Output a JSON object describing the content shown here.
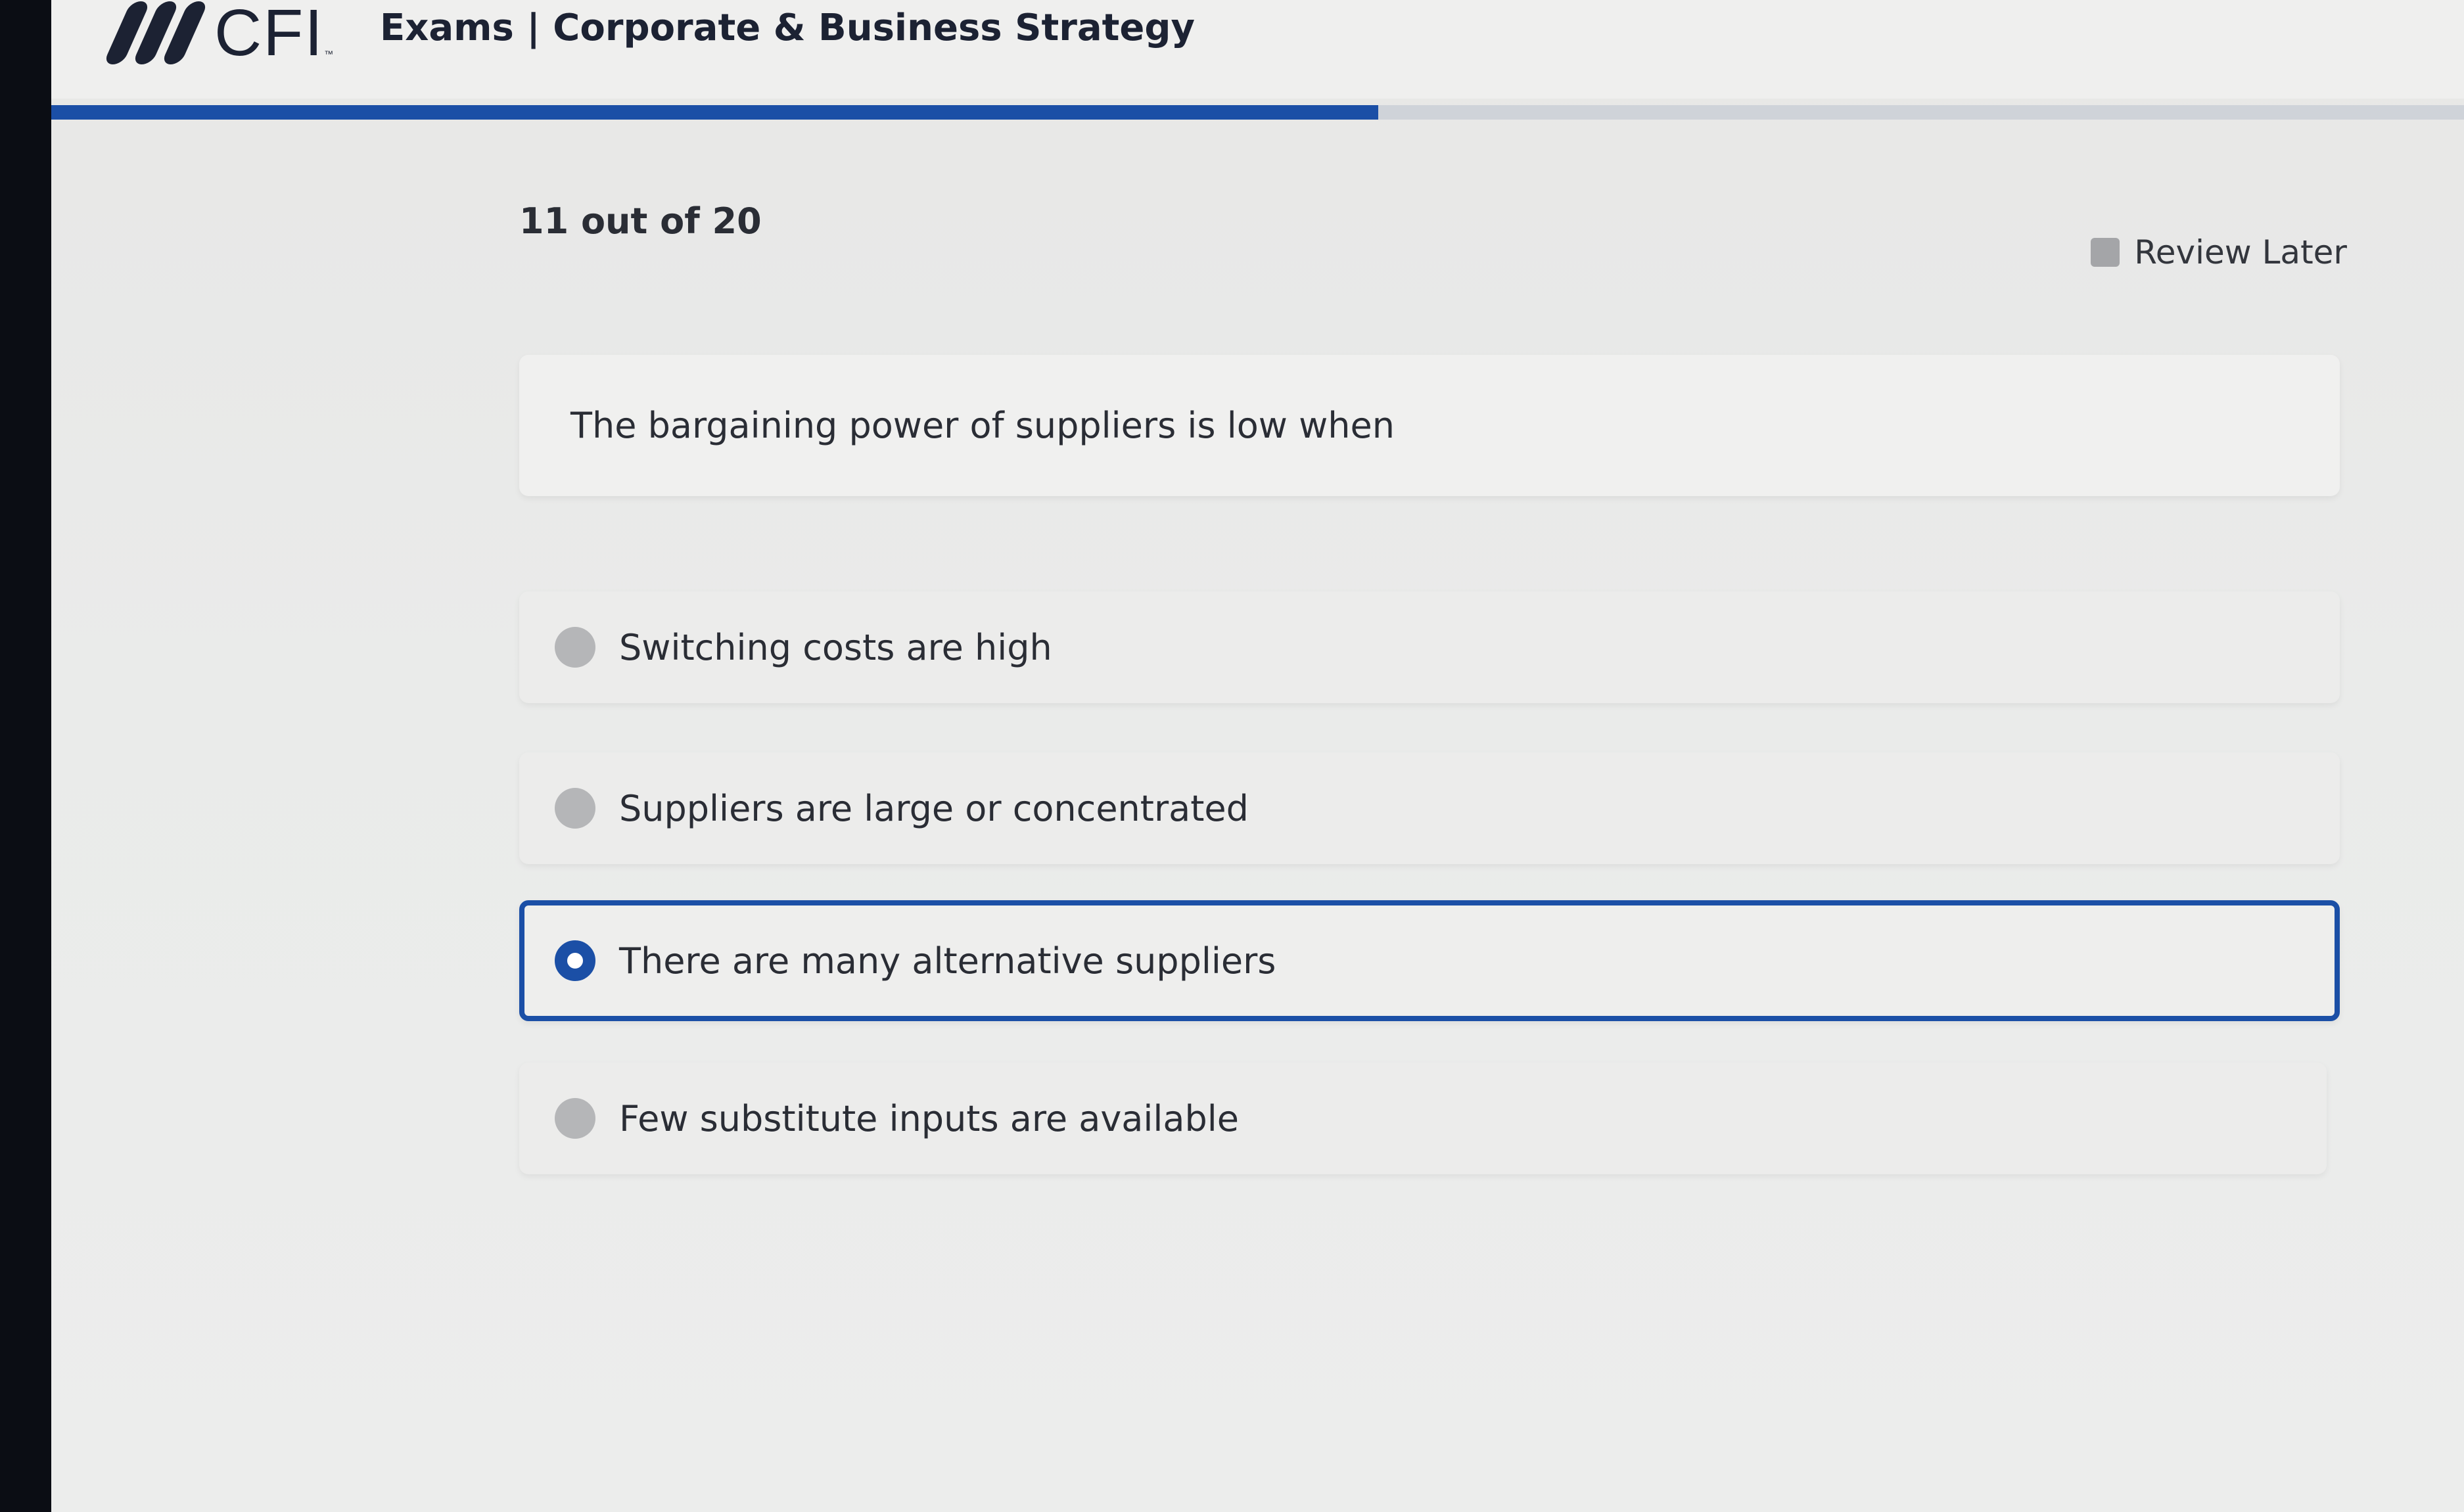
{
  "header": {
    "logo_text": "CFI",
    "logo_tm": "™",
    "title": "Exams | Corporate & Business Strategy"
  },
  "progress": {
    "current": 11,
    "total": 20,
    "fraction": 0.55,
    "counter_text": "11 out of 20",
    "color": "#1b4fa6"
  },
  "review": {
    "label": "Review Later",
    "checked": false
  },
  "question": {
    "text": "The bargaining power of suppliers is low when"
  },
  "options": [
    {
      "label": "Switching costs are high",
      "selected": false
    },
    {
      "label": "Suppliers are large or concentrated",
      "selected": false
    },
    {
      "label": "There are many alternative suppliers",
      "selected": true
    },
    {
      "label": "Few substitute inputs are available",
      "selected": false
    }
  ]
}
